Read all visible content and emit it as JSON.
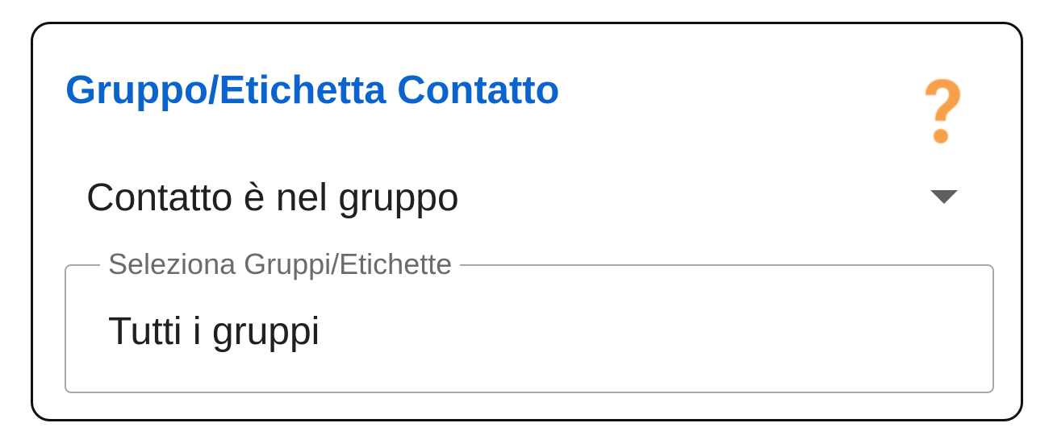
{
  "card": {
    "title": "Gruppo/Etichetta Contatto",
    "help_icon": "question-mark-icon",
    "help_color": "#f8a04a",
    "title_color": "#0b63ce"
  },
  "condition_select": {
    "selected_value": "Contatto è nel gruppo",
    "arrow_icon": "dropdown-arrow-icon"
  },
  "groups_field": {
    "label": "Seleziona Gruppi/Etichette",
    "value": "Tutti i gruppi"
  }
}
